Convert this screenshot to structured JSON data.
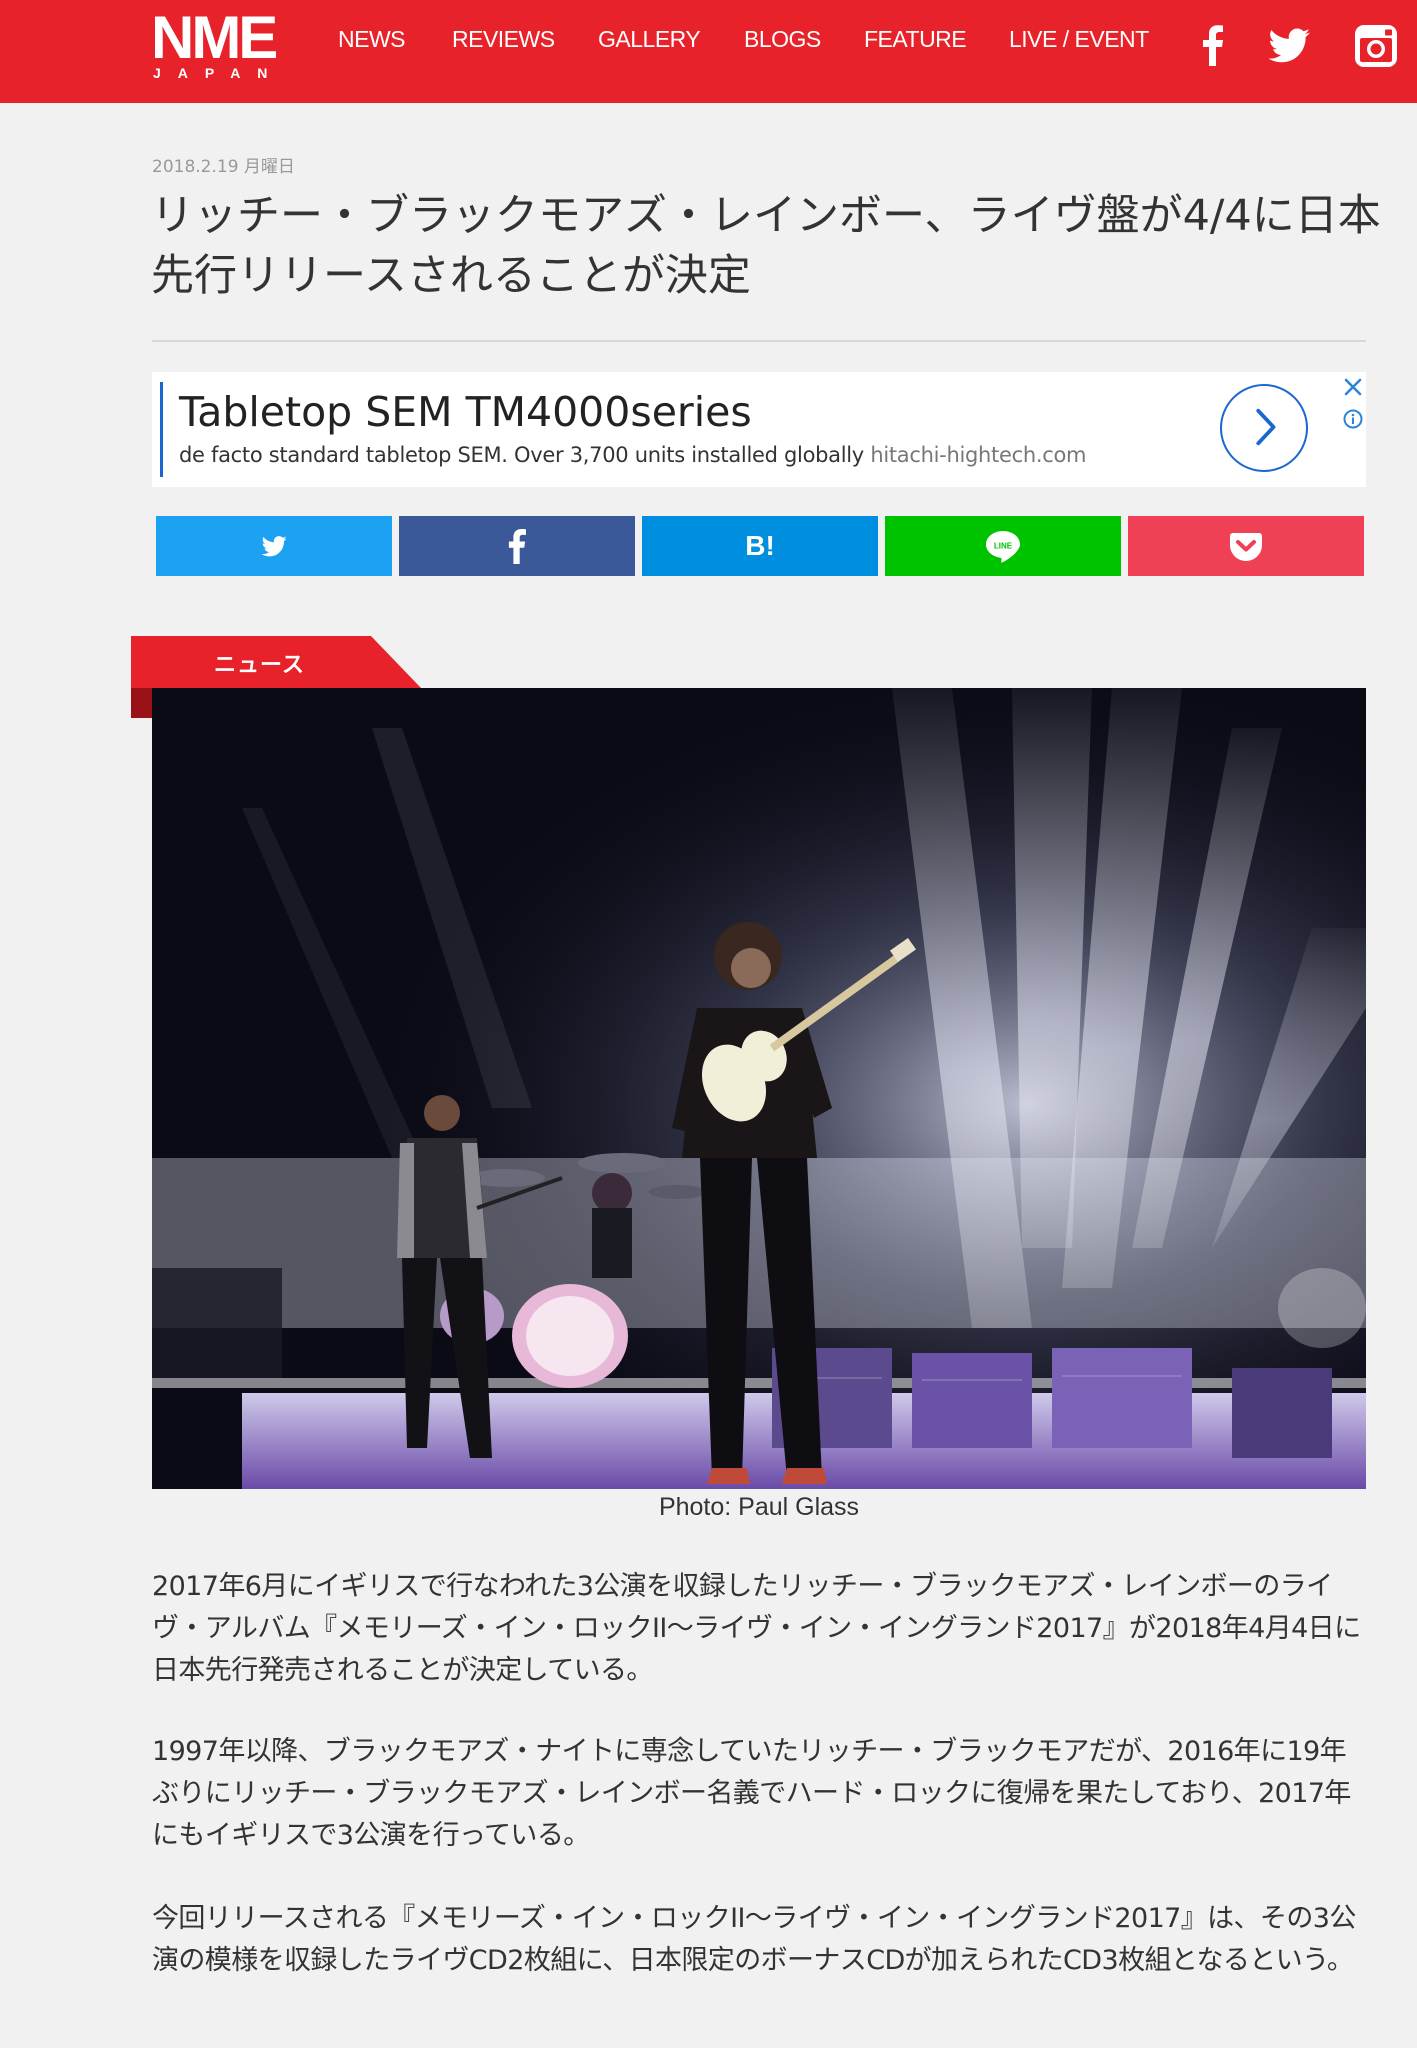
{
  "header": {
    "logo_main": "NME",
    "logo_sub": "JAPAN",
    "nav": [
      "NEWS",
      "REVIEWS",
      "GALLERY",
      "BLOGS",
      "FEATURE",
      "LIVE / EVENT"
    ],
    "social_icons": [
      "facebook-icon",
      "twitter-icon",
      "instagram-icon"
    ],
    "brand_color": "#e8222a"
  },
  "article": {
    "date": "2018.2.19 月曜日",
    "title": "リッチー・ブラックモアズ・レインボー、ライヴ盤が4/4に日本先行リリースされることが決定",
    "category": "ニュース",
    "photo_caption": "Photo: Paul Glass",
    "paragraphs": [
      "2017年6月にイギリスで行なわれた3公演を収録したリッチー・ブラックモアズ・レインボーのライヴ・アルバム『メモリーズ・イン・ロックII〜ライヴ・イン・イングランド2017』が2018年4月4日に日本先行発売されることが決定している。",
      "1997年以降、ブラックモアズ・ナイトに専念していたリッチー・ブラックモアだが、2016年に19年ぶりにリッチー・ブラックモアズ・レインボー名義でハード・ロックに復帰を果たしており、2017年にもイギリスで3公演を行っている。",
      "今回リリースされる『メモリーズ・イン・ロックII〜ライヴ・イン・イングランド2017』は、その3公演の模様を収録したライヴCD2枚組に、日本限定のボーナスCDが加えられたCD3枚組となるという。"
    ]
  },
  "ad": {
    "headline": "Tabletop SEM TM4000series",
    "description": "de facto standard tabletop SEM. Over 3,700 units installed globally",
    "domain": "hitachi-hightech.com",
    "accent_color": "#1a67d2"
  },
  "share": {
    "buttons": [
      {
        "name": "twitter",
        "label": "",
        "color": "#1da1f2"
      },
      {
        "name": "facebook",
        "label": "f",
        "color": "#3b5998"
      },
      {
        "name": "hatena",
        "label": "B!",
        "color": "#008fde"
      },
      {
        "name": "line",
        "label": "LINE",
        "color": "#00c300"
      },
      {
        "name": "pocket",
        "label": "",
        "color": "#ef4056"
      }
    ]
  }
}
